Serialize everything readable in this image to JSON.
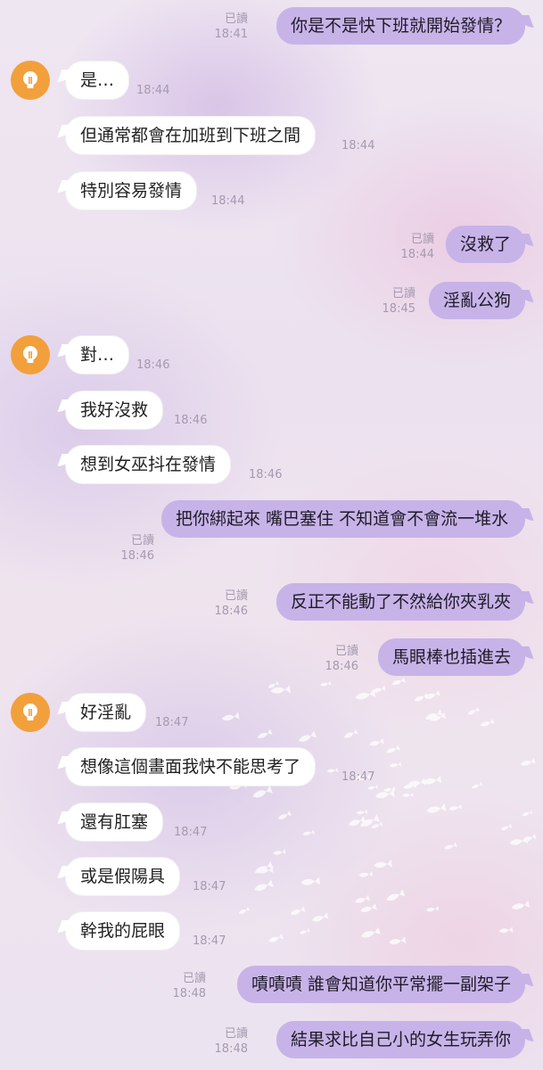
{
  "theme": {
    "outgoing_bubble_color": "#c7b3e8",
    "incoming_bubble_color": "#ffffff",
    "avatar_color": "#f2a03c",
    "meta_text_color": "#a59ab0"
  },
  "contact": {
    "avatar_icon": "lightbulb-icon"
  },
  "messages": [
    {
      "direction": "outgoing",
      "text": "你是不是快下班就開始發情？",
      "read_label": "已讀",
      "time": "18:41"
    },
    {
      "direction": "incoming",
      "text": "是…",
      "time": "18:44",
      "show_avatar": true
    },
    {
      "direction": "incoming",
      "text": "但通常都會在加班到下班之間",
      "time": "18:44"
    },
    {
      "direction": "incoming",
      "text": "特別容易發情",
      "time": "18:44"
    },
    {
      "direction": "outgoing",
      "text": "沒救了",
      "read_label": "已讀",
      "time": "18:44"
    },
    {
      "direction": "outgoing",
      "text": "淫亂公狗",
      "read_label": "已讀",
      "time": "18:45"
    },
    {
      "direction": "incoming",
      "text": "對…",
      "time": "18:46",
      "show_avatar": true
    },
    {
      "direction": "incoming",
      "text": "我好沒救",
      "time": "18:46"
    },
    {
      "direction": "incoming",
      "text": "想到女巫抖在發情",
      "time": "18:46"
    },
    {
      "direction": "outgoing",
      "text": "把你綁起來 嘴巴塞住 不知道會不會流一堆水",
      "read_label": "已讀",
      "time": "18:46"
    },
    {
      "direction": "outgoing",
      "text": "反正不能動了不然給你夾乳夾",
      "read_label": "已讀",
      "time": "18:46"
    },
    {
      "direction": "outgoing",
      "text": "馬眼棒也插進去",
      "read_label": "已讀",
      "time": "18:46"
    },
    {
      "direction": "incoming",
      "text": "好淫亂",
      "time": "18:47",
      "show_avatar": true
    },
    {
      "direction": "incoming",
      "text": "想像這個畫面我快不能思考了",
      "time": "18:47"
    },
    {
      "direction": "incoming",
      "text": "還有肛塞",
      "time": "18:47"
    },
    {
      "direction": "incoming",
      "text": "或是假陽具",
      "time": "18:47"
    },
    {
      "direction": "incoming",
      "text": "幹我的屁眼",
      "time": "18:47"
    },
    {
      "direction": "outgoing",
      "text": "嘖嘖嘖 誰會知道你平常擺一副架子",
      "read_label": "已讀",
      "time": "18:48"
    },
    {
      "direction": "outgoing",
      "text": "結果求比自己小的女生玩弄你",
      "read_label": "已讀",
      "time": "18:48"
    }
  ]
}
